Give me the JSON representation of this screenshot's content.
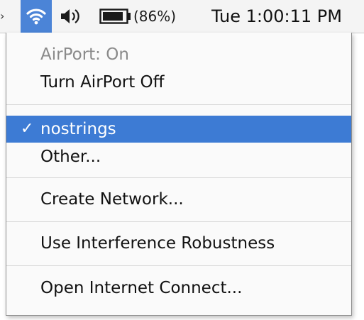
{
  "menubar": {
    "edge_glyph": "›",
    "battery_label": "(86%)",
    "clock": "Tue 1:00:11 PM",
    "icons": {
      "airport": "wifi-icon",
      "volume": "speaker-icon",
      "battery": "battery-icon"
    }
  },
  "airport_menu": {
    "status": "AirPort: On",
    "turn_off": "Turn AirPort Off",
    "network_selected": "nostrings",
    "check": "✓",
    "other": "Other...",
    "create_network": "Create Network...",
    "interference": "Use Interference Robustness",
    "internet_connect": "Open Internet Connect..."
  },
  "colors": {
    "highlight": "#3d7bd4",
    "menubar_selected": "#4b84d7",
    "disabled_text": "#8a8a8a"
  }
}
